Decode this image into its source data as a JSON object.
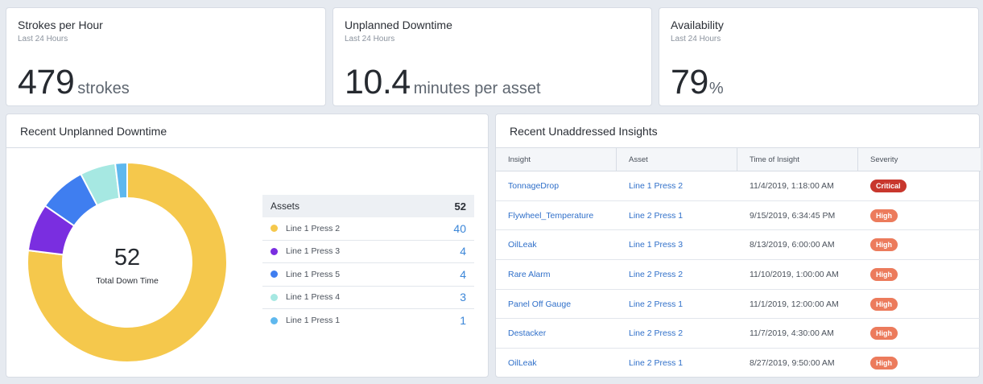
{
  "kpis": [
    {
      "title": "Strokes per Hour",
      "subtitle": "Last 24 Hours",
      "value": "479",
      "unit": "strokes"
    },
    {
      "title": "Unplanned Downtime",
      "subtitle": "Last 24 Hours",
      "value": "10.4",
      "unit": "minutes per asset"
    },
    {
      "title": "Availability",
      "subtitle": "Last 24 Hours",
      "value": "79",
      "unit": "%"
    }
  ],
  "downtime": {
    "title": "Recent Unplanned Downtime",
    "center_value": "52",
    "center_label": "Total Down Time",
    "legend_header": "Assets",
    "legend_total": "52",
    "items": [
      {
        "name": "Line 1 Press 2",
        "value": 40,
        "color": "#f5c84c"
      },
      {
        "name": "Line 1 Press 3",
        "value": 4,
        "color": "#7a2ee0"
      },
      {
        "name": "Line 1 Press 5",
        "value": 4,
        "color": "#3f7ef0"
      },
      {
        "name": "Line 1 Press 4",
        "value": 3,
        "color": "#a6e8e2"
      },
      {
        "name": "Line 1 Press 1",
        "value": 1,
        "color": "#5fb8ee"
      }
    ]
  },
  "chart_data": {
    "type": "pie",
    "categories": [
      "Line 1 Press 2",
      "Line 1 Press 3",
      "Line 1 Press 5",
      "Line 1 Press 4",
      "Line 1 Press 1"
    ],
    "values": [
      40,
      4,
      4,
      3,
      1
    ],
    "title": "Recent Unplanned Downtime"
  },
  "insights": {
    "title": "Recent Unaddressed Insights",
    "columns": [
      "Insight",
      "Asset",
      "Time of Insight",
      "Severity"
    ],
    "severity_colors": {
      "Critical": "#c8372d",
      "High": "#ec7b5c"
    },
    "rows": [
      {
        "insight": "TonnageDrop",
        "asset": "Line 1 Press 2",
        "time": "11/4/2019, 1:18:00 AM",
        "severity": "Critical"
      },
      {
        "insight": "Flywheel_Temperature",
        "asset": "Line 2 Press 1",
        "time": "9/15/2019, 6:34:45 PM",
        "severity": "High"
      },
      {
        "insight": "OilLeak",
        "asset": "Line 1 Press 3",
        "time": "8/13/2019, 6:00:00 AM",
        "severity": "High"
      },
      {
        "insight": "Rare Alarm",
        "asset": "Line 2 Press 2",
        "time": "11/10/2019, 1:00:00 AM",
        "severity": "High"
      },
      {
        "insight": "Panel Off Gauge",
        "asset": "Line 2 Press 1",
        "time": "11/1/2019, 12:00:00 AM",
        "severity": "High"
      },
      {
        "insight": "Destacker",
        "asset": "Line 2 Press 2",
        "time": "11/7/2019, 4:30:00 AM",
        "severity": "High"
      },
      {
        "insight": "OilLeak",
        "asset": "Line 2 Press 1",
        "time": "8/27/2019, 9:50:00 AM",
        "severity": "High"
      }
    ]
  }
}
